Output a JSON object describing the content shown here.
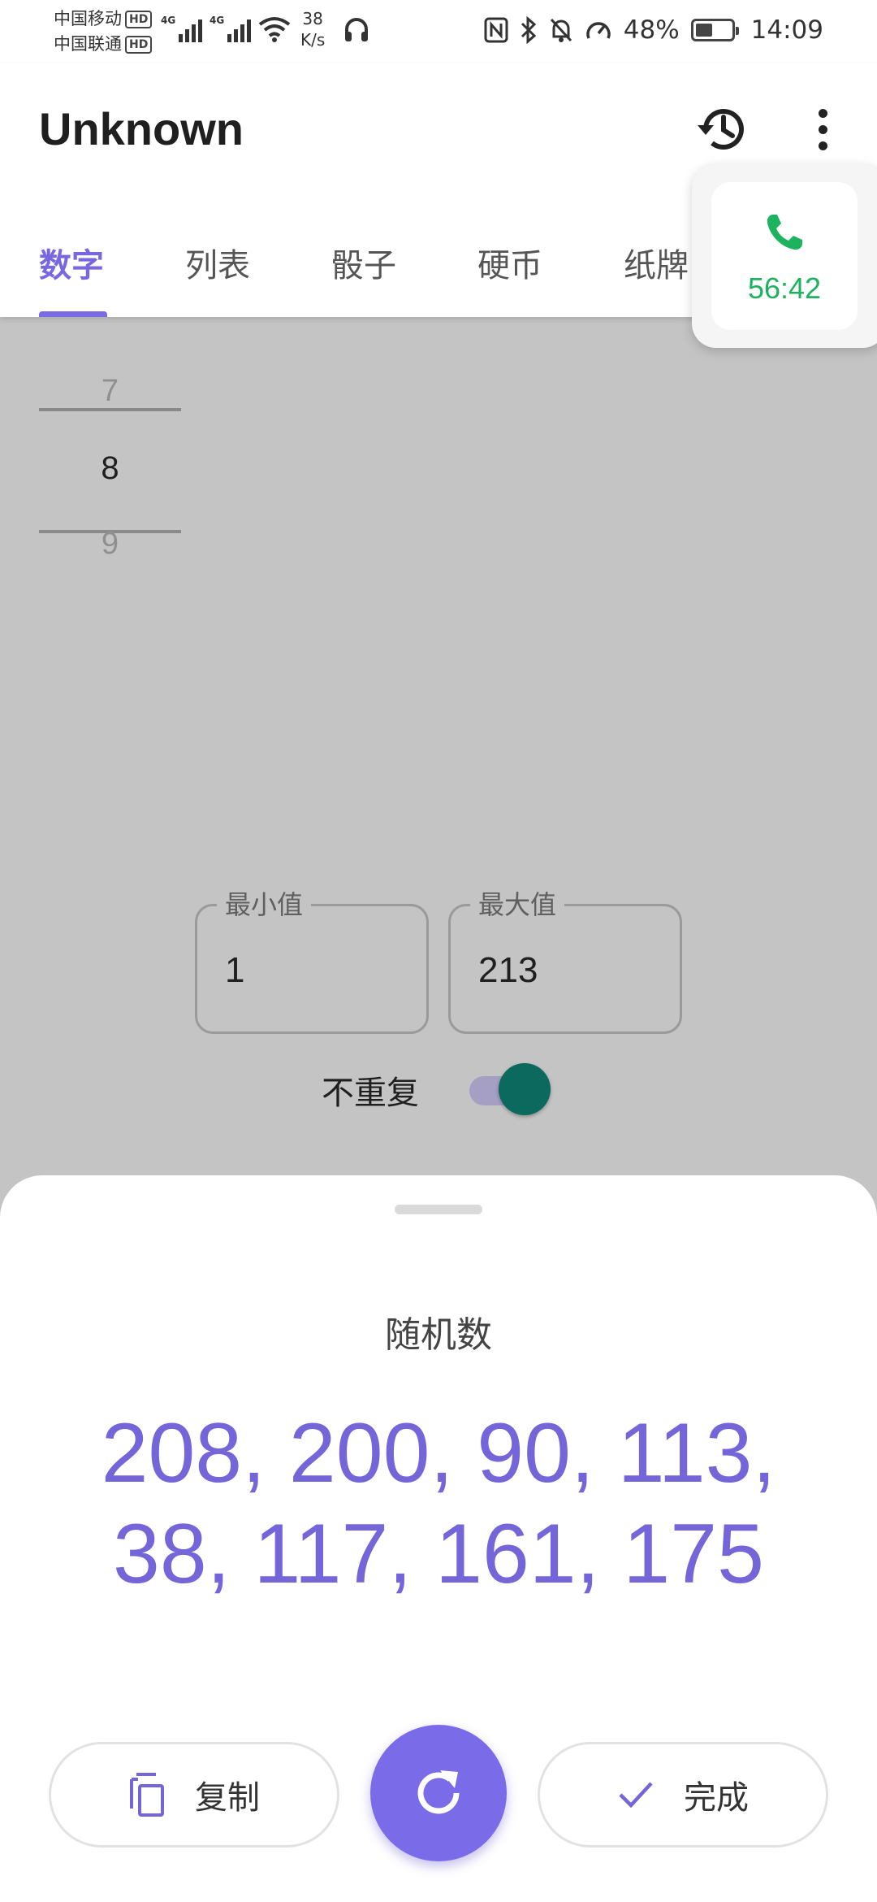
{
  "status_bar": {
    "carrier_1": "中国移动",
    "carrier_2": "中国联通",
    "hd_badge": "HD",
    "network_1": "4G",
    "network_2": "4G",
    "net_speed_value": "38",
    "net_speed_unit": "K/s",
    "battery_percent": "48%",
    "battery_level": 0.48,
    "time": "14:09",
    "icons": [
      "nfc-icon",
      "bluetooth-icon",
      "mute-bell-icon",
      "speed-gauge-icon",
      "battery-icon",
      "wifi-icon",
      "headset-icon",
      "signal-icon"
    ]
  },
  "app_bar": {
    "title": "Unknown",
    "actions": [
      "history-icon",
      "more-vertical-icon"
    ]
  },
  "tabs": [
    {
      "label": "数字",
      "active": true
    },
    {
      "label": "列表",
      "active": false
    },
    {
      "label": "骰子",
      "active": false
    },
    {
      "label": "硬币",
      "active": false
    },
    {
      "label": "纸牌",
      "active": false
    }
  ],
  "call_bubble": {
    "icon": "phone-icon",
    "duration": "56:42"
  },
  "picker": {
    "prev": "7",
    "current": "8",
    "next": "9"
  },
  "range": {
    "min_label": "最小值",
    "min_value": "1",
    "max_label": "最大值",
    "max_value": "213"
  },
  "no_repeat": {
    "label": "不重复",
    "enabled": true
  },
  "sheet": {
    "title": "随机数",
    "result_line_1": "208, 200, 90, 113,",
    "result_line_2": "38, 117, 161, 175",
    "copy_label": "复制",
    "done_label": "完成",
    "icons": [
      "copy-icon",
      "refresh-icon",
      "check-icon"
    ]
  },
  "colors": {
    "accent": "#7a6be9",
    "switch_thumb": "#0b6a5d",
    "call_green": "#1db35e",
    "scrim": "#c4c4c4"
  }
}
